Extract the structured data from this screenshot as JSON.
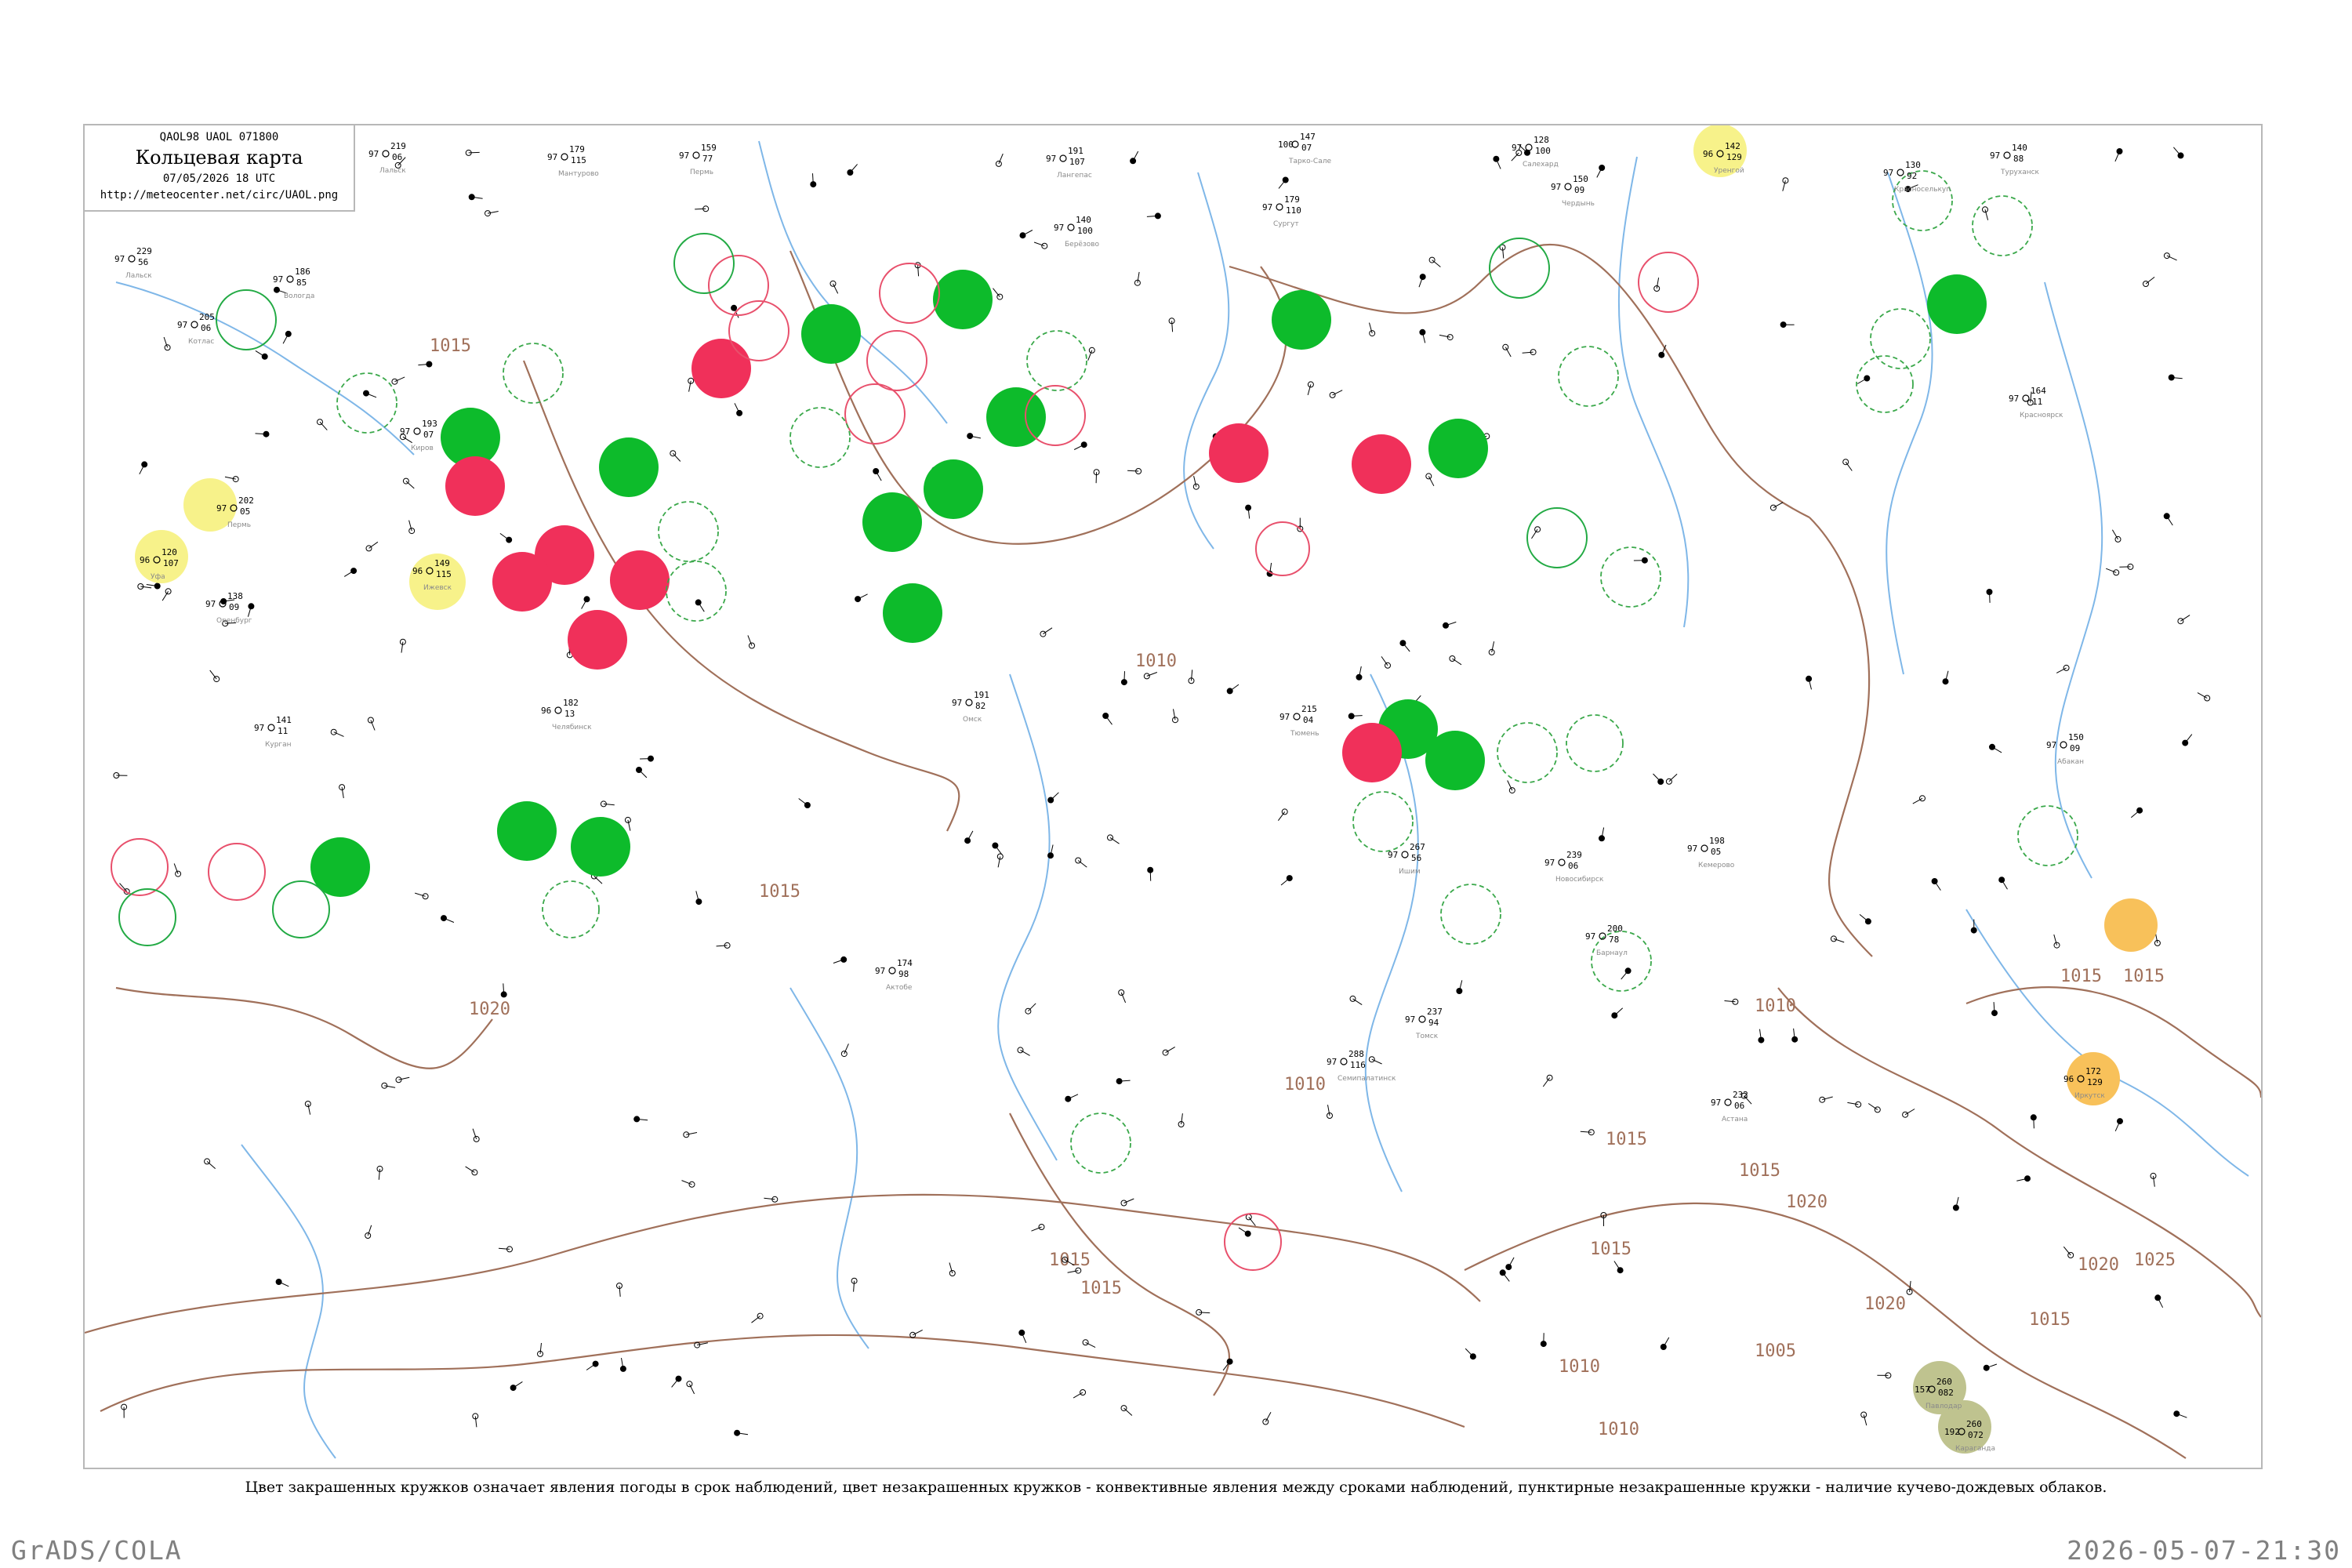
{
  "header": {
    "code": "QAOL98  UAOL  071800",
    "title": "Кольцевая карта",
    "datetime": "07/05/2026 18 UTC",
    "url": "http://meteocenter.net/circ/UAOL.png"
  },
  "caption": "Цвет закрашенных кружков означает явления погоды в срок наблюдений, цвет незакрашенных кружков - конвективные явления между сроками наблюдений, пунктирные незакрашенные кружки - наличие кучево-дождевых облаков.",
  "footer": {
    "left": "GrADS/COLA",
    "right": "2026-05-07-21:30"
  },
  "colors": {
    "isobar": "#a0705a",
    "river": "#7fb7e8",
    "shower_green": "#0dbb2b",
    "thunder_red": "#f0305a",
    "haze_yellow": "#f7f28a",
    "dust_orange": "#f8c15a",
    "olive": "#bfc38f"
  },
  "isobar_labels": [
    "1015",
    "1020",
    "1015",
    "1010",
    "1015",
    "1010",
    "1015",
    "1015",
    "1010",
    "1015",
    "1015",
    "1020",
    "1025",
    "1020",
    "1020",
    "1015",
    "1005",
    "1010",
    "1015",
    "1010",
    "1015"
  ],
  "stations": [
    {
      "name": "Лальск",
      "p": "219",
      "t": "97",
      "w": "06"
    },
    {
      "name": "Мантурово",
      "p": "179",
      "t": "97",
      "w": "115"
    },
    {
      "name": "Пермь",
      "p": "159",
      "t": "97",
      "w": "77"
    },
    {
      "name": "Лангепас",
      "p": "191",
      "t": "97",
      "w": "107"
    },
    {
      "name": "Чердынь",
      "p": "150",
      "t": "97",
      "w": "09"
    },
    {
      "name": "Берёзово",
      "p": "140",
      "t": "97",
      "w": "100"
    },
    {
      "name": "Тарко-Сале",
      "p": "147",
      "t": "100",
      "w": "07"
    },
    {
      "name": "Сургут",
      "p": "179",
      "t": "97",
      "w": "110"
    },
    {
      "name": "Салехард",
      "p": "128",
      "t": "97",
      "w": "100"
    },
    {
      "name": "Уренгой",
      "p": "142",
      "t": "96",
      "w": "129"
    },
    {
      "name": "Красноселькуп",
      "p": "130",
      "t": "97",
      "w": "92"
    },
    {
      "name": "Туруханск",
      "p": "140",
      "t": "97",
      "w": "88"
    },
    {
      "name": "Лальск",
      "p": "229",
      "t": "97",
      "w": "56"
    },
    {
      "name": "Котлас",
      "p": "205",
      "t": "97",
      "w": "06"
    },
    {
      "name": "Вологда",
      "p": "186",
      "t": "97",
      "w": "85"
    },
    {
      "name": "Киров",
      "p": "193",
      "t": "97",
      "w": "07"
    },
    {
      "name": "Ижевск",
      "p": "149",
      "t": "96",
      "w": "115"
    },
    {
      "name": "Пермь",
      "p": "202",
      "t": "97",
      "w": "05"
    },
    {
      "name": "Уфа",
      "p": "120",
      "t": "96",
      "w": "107"
    },
    {
      "name": "Оренбург",
      "p": "138",
      "t": "97",
      "w": "09"
    },
    {
      "name": "Челябинск",
      "p": "182",
      "t": "96",
      "w": "13"
    },
    {
      "name": "Курган",
      "p": "141",
      "t": "97",
      "w": "11"
    },
    {
      "name": "Омск",
      "p": "191",
      "t": "97",
      "w": "82"
    },
    {
      "name": "Тюмень",
      "p": "215",
      "t": "97",
      "w": "04"
    },
    {
      "name": "Ишим",
      "p": "267",
      "t": "97",
      "w": "56"
    },
    {
      "name": "Новосибирск",
      "p": "239",
      "t": "97",
      "w": "06"
    },
    {
      "name": "Барнаул",
      "p": "200",
      "t": "97",
      "w": "78"
    },
    {
      "name": "Кемерово",
      "p": "198",
      "t": "97",
      "w": "05"
    },
    {
      "name": "Томск",
      "p": "237",
      "t": "97",
      "w": "94"
    },
    {
      "name": "Красноярск",
      "p": "164",
      "t": "97",
      "w": "11"
    },
    {
      "name": "Абакан",
      "p": "150",
      "t": "97",
      "w": "09"
    },
    {
      "name": "Иркутск",
      "p": "172",
      "t": "96",
      "w": "129"
    },
    {
      "name": "Актобе",
      "p": "174",
      "t": "97",
      "w": "98"
    },
    {
      "name": "Семипалатинск",
      "p": "288",
      "t": "97",
      "w": "116"
    },
    {
      "name": "Павлодар",
      "p": "260",
      "t": "157",
      "w": "082"
    },
    {
      "name": "Караганда",
      "p": "260",
      "t": "192",
      "w": "072"
    },
    {
      "name": "Астана",
      "p": "232",
      "t": "97",
      "w": "06"
    }
  ]
}
